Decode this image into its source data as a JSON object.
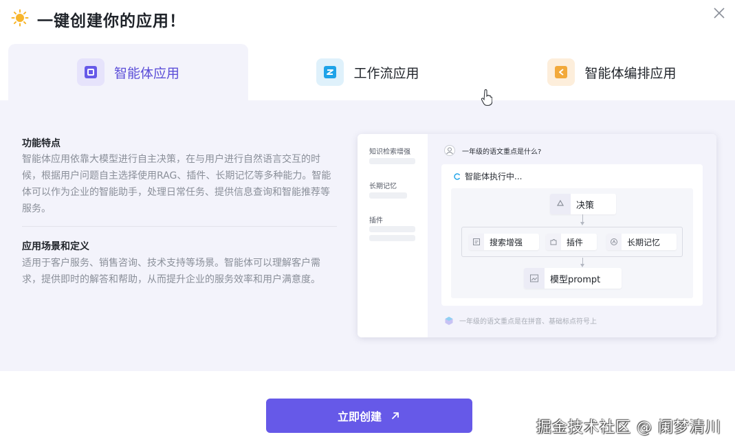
{
  "header": {
    "title": "一键创建你的应用！"
  },
  "tabs": [
    {
      "label": "智能体应用",
      "active": true,
      "icon": "agent-app-icon",
      "icon_color": "#6659e8"
    },
    {
      "label": "工作流应用",
      "active": false,
      "icon": "workflow-app-icon",
      "icon_color": "#1fa3e8"
    },
    {
      "label": "智能体编排应用",
      "active": false,
      "icon": "agent-orchestration-icon",
      "icon_color": "#f2a93b"
    }
  ],
  "features": {
    "title": "功能特点",
    "text": "智能体应用依靠大模型进行自主决策，在与用户进行自然语言交互的时候，根据用户问题自主选择使用RAG、插件、长期记忆等多种能力。智能体可以作为企业的智能助手，处理日常任务、提供信息查询和智能推荐等服务。"
  },
  "scenarios": {
    "title": "应用场景和定义",
    "text": "适用于客户服务、销售咨询、技术支持等场景。智能体可以理解客户需求，提供即时的解答和帮助，从而提升企业的服务效率和用户满意度。"
  },
  "preview": {
    "sidebar": [
      "知识检索增强",
      "长期记忆",
      "插件"
    ],
    "question": "一年级的语文重点是什么?",
    "running": "智能体执行中...",
    "decision": "决策",
    "tools": [
      "搜索增强",
      "插件",
      "长期记忆"
    ],
    "model": "模型prompt",
    "answer": "一年级的语文重点是在拼音、基础标点符号上"
  },
  "create_button": {
    "label": "立即创建"
  },
  "watermark": "掘金技术社区 @ 阑梦清川",
  "colors": {
    "accent": "#6659e8",
    "panel_bg": "#f3f3fb"
  }
}
